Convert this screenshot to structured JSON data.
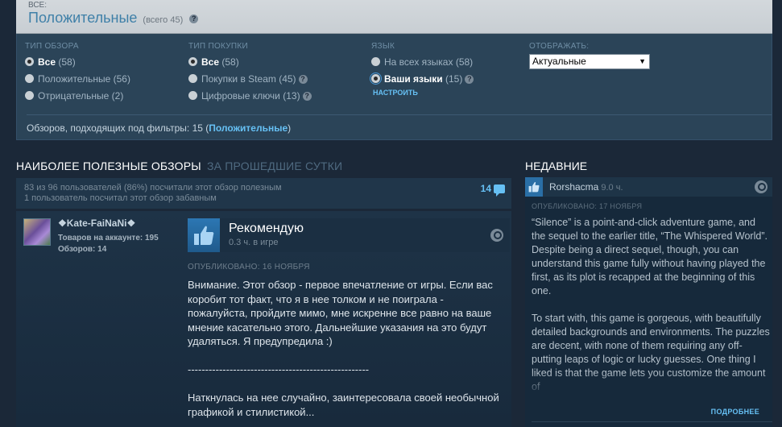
{
  "summary": {
    "small_label": "ВСЕ:",
    "rating": "Положительные",
    "total": "(всего 45)"
  },
  "filters": {
    "review_type": {
      "header": "ТИП ОБЗОРА",
      "options": [
        {
          "label": "Все",
          "count": "(58)"
        },
        {
          "label": "Положительные",
          "count": "(56)"
        },
        {
          "label": "Отрицательные",
          "count": "(2)"
        }
      ]
    },
    "purchase_type": {
      "header": "ТИП ПОКУПКИ",
      "options": [
        {
          "label": "Все",
          "count": "(58)"
        },
        {
          "label": "Покупки в Steam",
          "count": "(45)"
        },
        {
          "label": "Цифровые ключи",
          "count": "(13)"
        }
      ]
    },
    "language": {
      "header": "ЯЗЫК",
      "options": [
        {
          "label": "На всех языках",
          "count": "(58)"
        },
        {
          "label": "Ваши языки",
          "count": "(15)"
        }
      ],
      "configure": "НАСТРОИТЬ"
    },
    "display": {
      "header": "ОТОБРАЖАТЬ:",
      "selected": "Актуальные"
    },
    "match_prefix": "Обзоров, подходящих под фильтры: 15 (",
    "match_link": "Положительные",
    "match_suffix": ")"
  },
  "left": {
    "title": "НАИБОЛЕЕ ПОЛЕЗНЫЕ ОБЗОРЫ",
    "subtitle": "ЗА ПРОШЕДШИЕ СУТКИ",
    "helpful_line1": "83 из 96 пользователей (86%) посчитали этот обзор полезным",
    "helpful_line2": "1 пользователь посчитал этот обзор забавным",
    "comments": "14",
    "review": {
      "author": "❖Kate-FaiNaNi❖",
      "products": "Товаров на аккаунте: 195",
      "reviews": "Обзоров: 14",
      "verdict": "Рекомендую",
      "hours": "0.3 ч. в игре",
      "posted": "ОПУБЛИКОВАНО: 16 НОЯБРЯ",
      "text": "Внимание. Этот обзор - первое впечатление от игры. Если вас коробит тот факт, что я в нее толком и не поиграла - пожалуйста, пройдите мимо, мне искренне все равно на ваше мнение касательно этого. Дальнейшие указания на это будут удаляться. Я предупредила :)\n\n----------------------------------------------------\n\nНаткнулась на нее случайно, заинтересовала своей необычной графикой и стилистикой..."
    }
  },
  "right": {
    "title": "НЕДАВНИЕ",
    "author": "Rorshacma",
    "hours": "9.0 ч.",
    "posted": "ОПУБЛИКОВАНО: 17 НОЯБРЯ",
    "text": "“Silence” is a point-and-click adventure game, and the sequel to the earlier title, “The Whispered World”. Despite being a direct sequel, though, you can understand this game fully without having played the first, as its plot is recapped at the beginning of this one.\n\nTo start with, this game is gorgeous, with beautifully detailed backgrounds and environments. The puzzles are decent, with none of them requiring any off-putting leaps of logic or lucky guesses. One thing I liked is that the game lets you customize the amount of",
    "more": "ПОДРОБНЕЕ"
  }
}
